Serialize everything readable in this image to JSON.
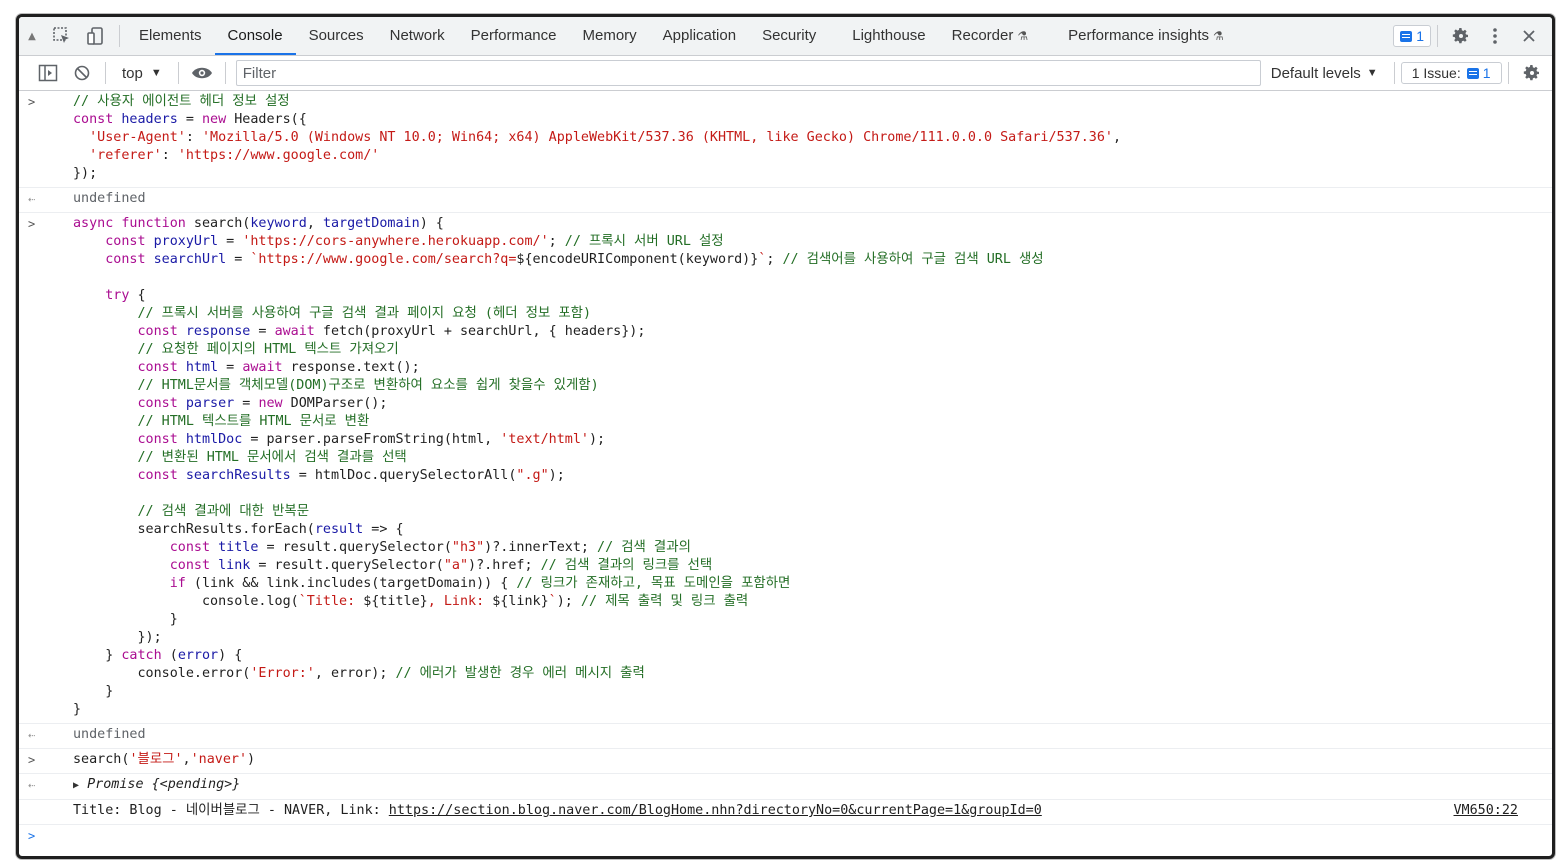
{
  "tabs": [
    {
      "label": "Elements"
    },
    {
      "label": "Console",
      "active": true
    },
    {
      "label": "Sources"
    },
    {
      "label": "Network"
    },
    {
      "label": "Performance"
    },
    {
      "label": "Memory"
    },
    {
      "label": "Application"
    },
    {
      "label": "Security"
    },
    {
      "label": "Lighthouse"
    },
    {
      "label": "Recorder",
      "flask": true
    },
    {
      "label": "Performance insights",
      "flask": true
    }
  ],
  "toolbar": {
    "message_count": "1"
  },
  "filterbar": {
    "context": "top",
    "filter_placeholder": "Filter",
    "levels_label": "Default levels",
    "issues_label": "1 Issue:",
    "issues_count": "1"
  },
  "console": {
    "entry1": [
      "<span class=\"c\">// 사용자 에이전트 헤더 정보 설정</span>",
      "<span class=\"k\">const</span> <span class=\"v\">headers</span> = <span class=\"k\">new</span> Headers({",
      "  <span class=\"s\">'User-Agent'</span>: <span class=\"s\">'Mozilla/5.0 (Windows NT 10.0; Win64; x64) AppleWebKit/537.36 (KHTML, like Gecko) Chrome/111.0.0.0 Safari/537.36'</span>,",
      "  <span class=\"s\">'referer'</span>: <span class=\"s\">'https://www.google.com/'</span>",
      "});"
    ],
    "result1": "undefined",
    "entry2": [
      "<span class=\"k\">async</span> <span class=\"k\">function</span> search(<span class=\"v\">keyword</span>, <span class=\"v\">targetDomain</span>) {",
      "    <span class=\"k\">const</span> <span class=\"v\">proxyUrl</span> = <span class=\"s\">'https://cors-anywhere.herokuapp.com/'</span>; <span class=\"c\">// 프록시 서버 URL 설정</span>",
      "    <span class=\"k\">const</span> <span class=\"v\">searchUrl</span> = <span class=\"s\">`https://www.google.com/search?q=</span>${encodeURIComponent(keyword)}<span class=\"s\">`</span>; <span class=\"c\">// 검색어를 사용하여 구글 검색 URL 생성</span>",
      "",
      "    <span class=\"k\">try</span> {",
      "        <span class=\"c\">// 프록시 서버를 사용하여 구글 검색 결과 페이지 요청 (헤더 정보 포함)</span>",
      "        <span class=\"k\">const</span> <span class=\"v\">response</span> = <span class=\"k\">await</span> fetch(proxyUrl + searchUrl, { headers});",
      "        <span class=\"c\">// 요청한 페이지의 HTML 텍스트 가져오기</span>",
      "        <span class=\"k\">const</span> <span class=\"v\">html</span> = <span class=\"k\">await</span> response.text();",
      "        <span class=\"c\">// HTML문서를 객체모델(DOM)구조로 변환하여 요소를 쉽게 찾을수 있게함)</span>",
      "        <span class=\"k\">const</span> <span class=\"v\">parser</span> = <span class=\"k\">new</span> DOMParser();",
      "        <span class=\"c\">// HTML 텍스트를 HTML 문서로 변환</span>",
      "        <span class=\"k\">const</span> <span class=\"v\">htmlDoc</span> = parser.parseFromString(html, <span class=\"s\">'text/html'</span>);",
      "        <span class=\"c\">// 변환된 HTML 문서에서 검색 결과를 선택</span>",
      "        <span class=\"k\">const</span> <span class=\"v\">searchResults</span> = htmlDoc.querySelectorAll(<span class=\"s\">\".g\"</span>);",
      "",
      "        <span class=\"c\">// 검색 결과에 대한 반복문</span>",
      "        searchResults.forEach(<span class=\"v\">result</span> => {",
      "            <span class=\"k\">const</span> <span class=\"v\">title</span> = result.querySelector(<span class=\"s\">\"h3\"</span>)?.innerText; <span class=\"c\">// 검색 결과의</span>",
      "            <span class=\"k\">const</span> <span class=\"v\">link</span> = result.querySelector(<span class=\"s\">\"a\"</span>)?.href; <span class=\"c\">// 검색 결과의 링크를 선택</span>",
      "            <span class=\"k\">if</span> (link &amp;&amp; link.includes(targetDomain)) { <span class=\"c\">// 링크가 존재하고, 목표 도메인을 포함하면</span>",
      "                console.log(<span class=\"s\">`Title: </span>${title}<span class=\"s\">, Link: </span>${link}<span class=\"s\">`</span>); <span class=\"c\">// 제목 출력 및 링크 출력</span>",
      "            }",
      "        });",
      "    } <span class=\"k\">catch</span> (<span class=\"v\">error</span>) {",
      "        console.error(<span class=\"s\">'Error:'</span>, error); <span class=\"c\">// 에러가 발생한 경우 에러 메시지 출력</span>",
      "    }",
      "}"
    ],
    "result2": "undefined",
    "entry3": "search(<span class=\"s\">'블로그'</span>,<span class=\"s\">'naver'</span>)",
    "promise_text": "Promise {<pending>}",
    "log_prefix": "Title: Blog - 네이버블로그 - NAVER, Link: ",
    "log_link": "https://section.blog.naver.com/BlogHome.nhn?directoryNo=0&currentPage=1&groupId=0",
    "log_source": "VM650:22"
  }
}
